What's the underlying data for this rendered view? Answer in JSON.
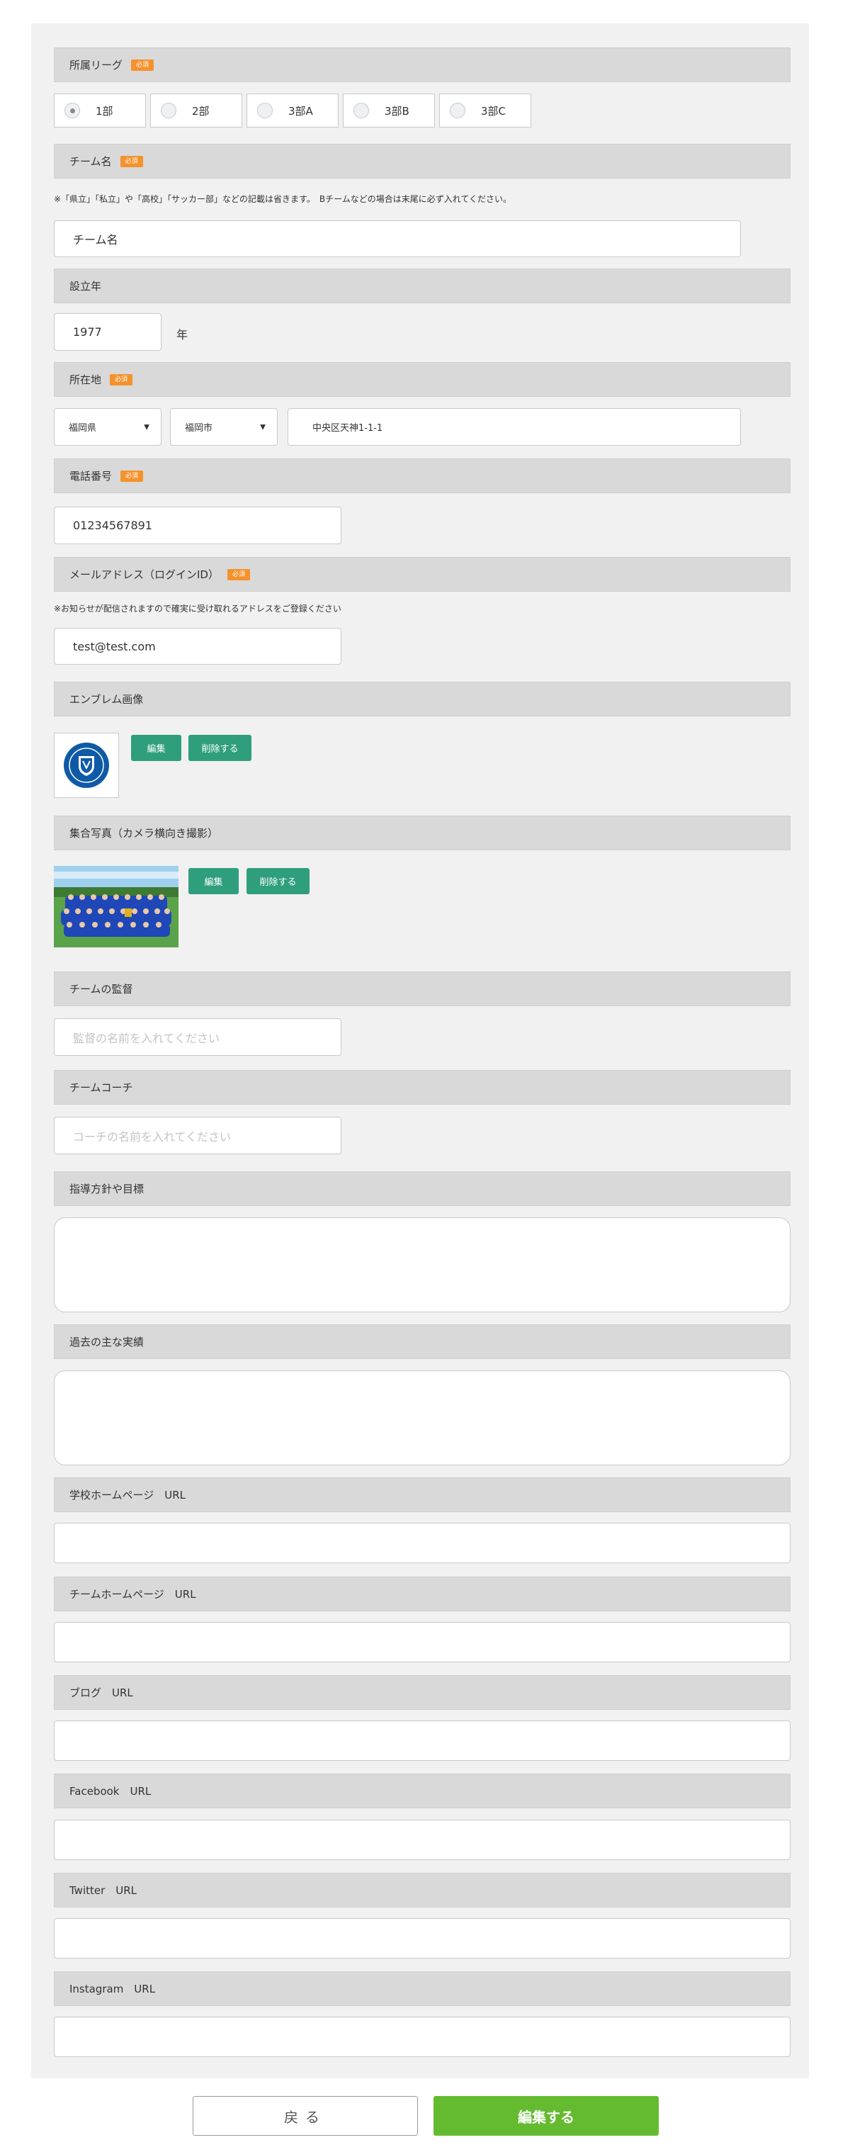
{
  "required_badge": "必須",
  "league": {
    "label": "所属リーグ",
    "options": [
      "1部",
      "2部",
      "3部A",
      "3部B",
      "3部C"
    ],
    "selected": "1部"
  },
  "team_name": {
    "label": "チーム名",
    "note": "※「県立」「私立」や「高校」「サッカー部」などの記載は省きます。　Bチームなどの場合は末尾に必ず入れてください。",
    "value": "チーム名"
  },
  "founded": {
    "label": "設立年",
    "value": "1977",
    "unit": "年"
  },
  "location": {
    "label": "所在地",
    "prefecture": "福岡県",
    "city": "福岡市",
    "address": "中央区天神1-1-1"
  },
  "phone": {
    "label": "電話番号",
    "value": "01234567891"
  },
  "email": {
    "label": "メールアドレス（ログインID）",
    "note": "※お知らせが配信されますので確実に受け取れるアドレスをご登録ください",
    "value": "test@test.com"
  },
  "emblem": {
    "label": "エンブレム画像",
    "edit": "編集",
    "delete": "削除する"
  },
  "group_photo": {
    "label": "集合写真（カメラ横向き撮影）",
    "edit": "編集",
    "delete": "削除する"
  },
  "manager": {
    "label": "チームの監督",
    "placeholder": "監督の名前を入れてください"
  },
  "coach": {
    "label": "チームコーチ",
    "placeholder": "コーチの名前を入れてください"
  },
  "policy": {
    "label": "指導方針や目標",
    "value": ""
  },
  "achievements": {
    "label": "過去の主な実績",
    "value": ""
  },
  "urls": [
    {
      "label": "学校ホームページ　URL",
      "value": ""
    },
    {
      "label": "チームホームページ　URL",
      "value": ""
    },
    {
      "label": "ブログ　URL",
      "value": ""
    },
    {
      "label": "Facebook　URL",
      "value": ""
    },
    {
      "label": "Twitter　URL",
      "value": ""
    },
    {
      "label": "Instagram　URL",
      "value": ""
    }
  ],
  "buttons": {
    "back": "戻る",
    "submit": "編集する"
  },
  "colors": {
    "accent_green": "#2f9e7c",
    "submit_green": "#64bb30",
    "badge_orange": "#f5922c"
  }
}
